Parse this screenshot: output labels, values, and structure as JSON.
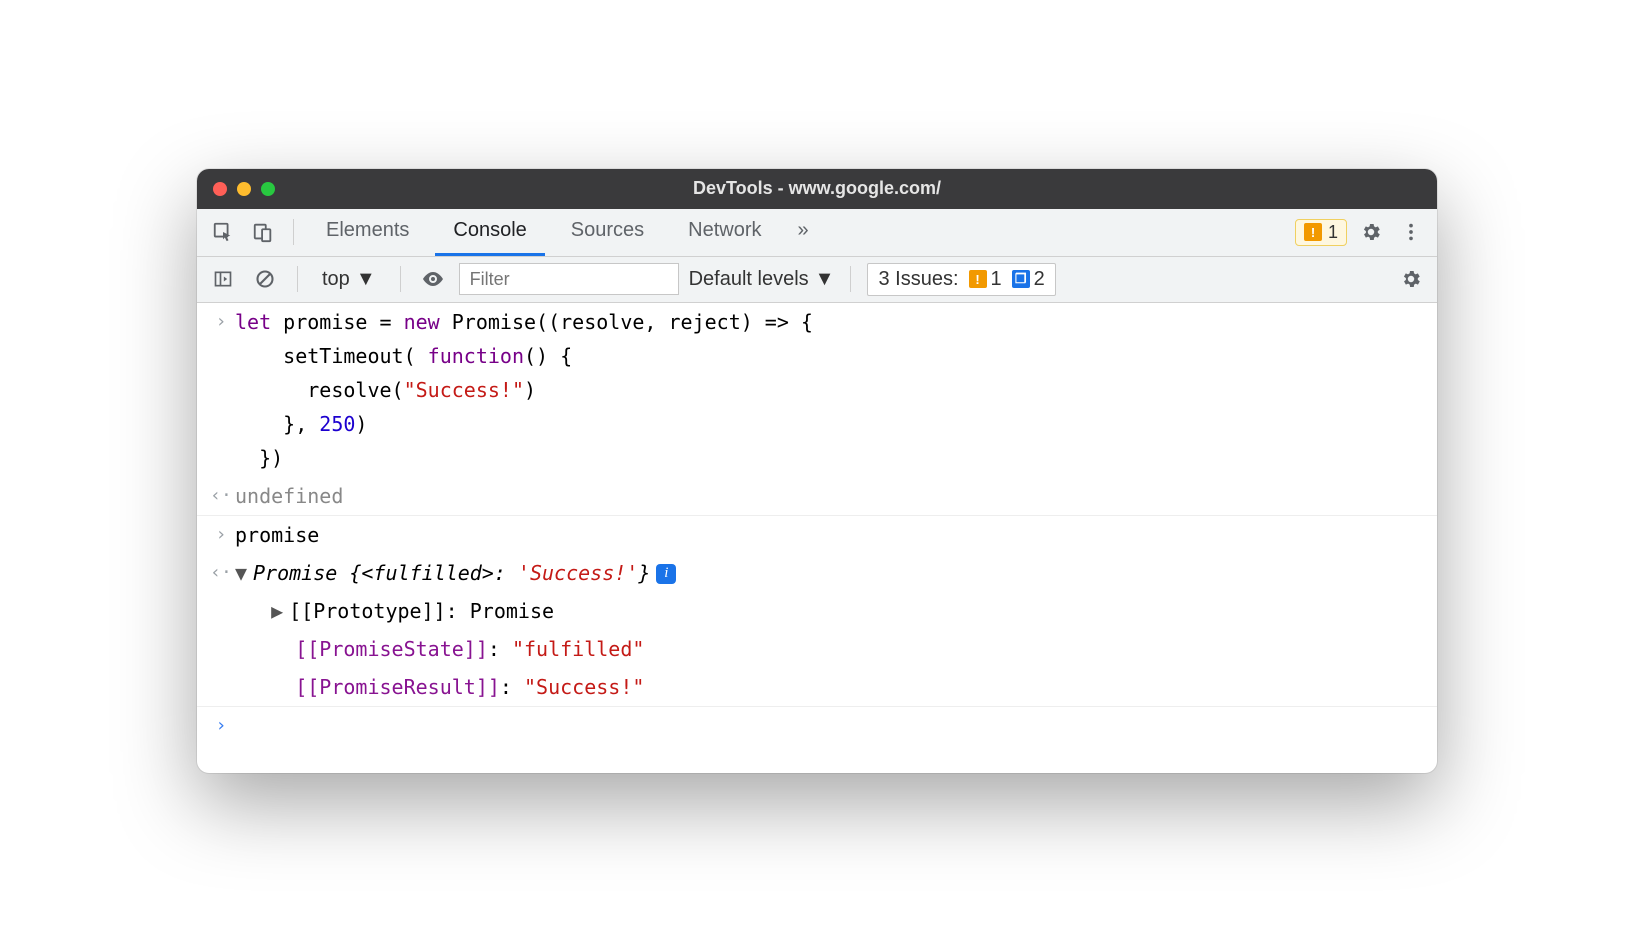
{
  "window": {
    "title": "DevTools - www.google.com/"
  },
  "tabs": {
    "items": [
      "Elements",
      "Console",
      "Sources",
      "Network"
    ],
    "active": "Console",
    "overflow": "»",
    "warn_count": "1"
  },
  "toolbar": {
    "context": "top",
    "filter_placeholder": "Filter",
    "levels_label": "Default levels",
    "issues_label": "3 Issues:",
    "issues_warn": "1",
    "issues_info": "2"
  },
  "console_lines": {
    "code1": "let promise = new Promise((resolve, reject) => {\n    setTimeout( function() {\n      resolve(\"Success!\")\n    }, 250)\n  })",
    "result1": "undefined",
    "code2": "promise",
    "result2_summary": "Promise {<fulfilled>: 'Success!'}",
    "prop_proto_label": "[[Prototype]]",
    "prop_proto_value": "Promise",
    "prop_state_label": "[[PromiseState]]",
    "prop_state_value": "\"fulfilled\"",
    "prop_result_label": "[[PromiseResult]]",
    "prop_result_value": "\"Success!\""
  }
}
